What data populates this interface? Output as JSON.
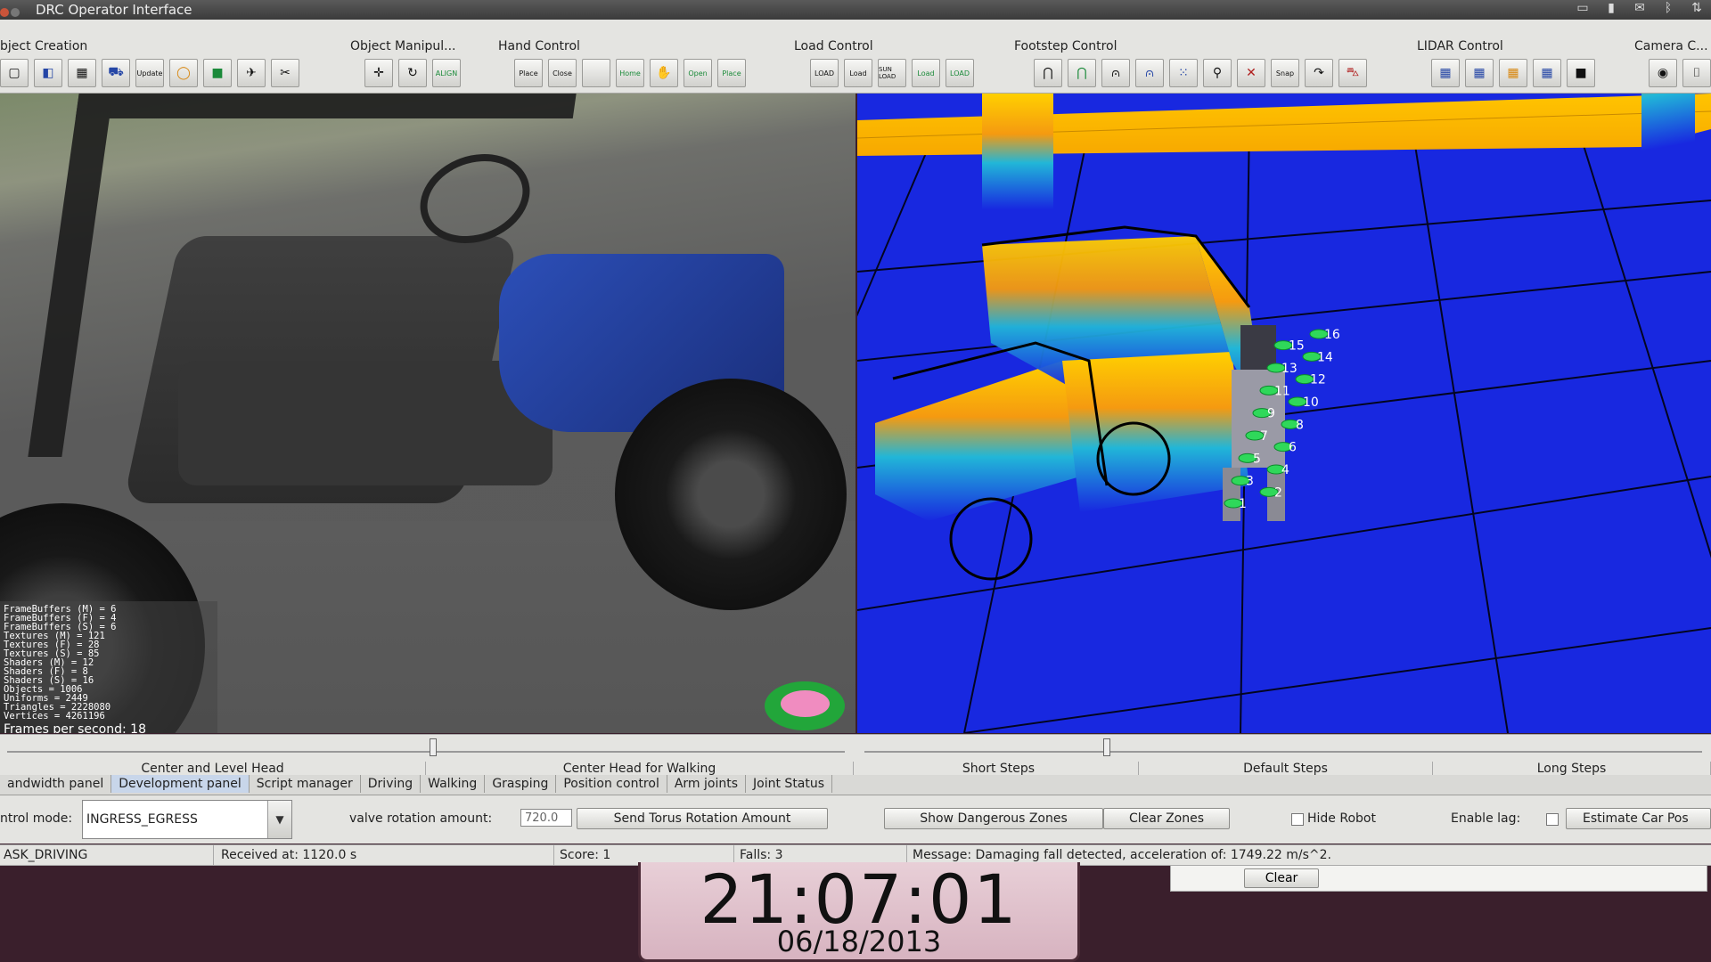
{
  "window": {
    "title": "DRC Operator Interface"
  },
  "toolbar": {
    "groups": [
      {
        "label": "bject Creation",
        "buttons": [
          "clear-icon",
          "car-model-icon",
          "grid-icon",
          "vehicle-icon",
          "update-icon",
          "torus-icon",
          "box-icon",
          "hose-icon",
          "tool-icon"
        ]
      },
      {
        "label": "Object Manipul...",
        "buttons": [
          "move-icon",
          "rotate-icon",
          "align-icon"
        ]
      },
      {
        "label": "Hand Control",
        "buttons": [
          "place-icon",
          "close-icon",
          "blank-icon",
          "home-icon",
          "grasp-icon",
          "open-icon",
          "place-icon"
        ]
      },
      {
        "label": "Load Control",
        "buttons": [
          "load-icon",
          "load-icon",
          "sun-load-icon",
          "load-icon",
          "load-icon"
        ]
      },
      {
        "label": "Footstep Control",
        "buttons": [
          "step-icon",
          "step-icon",
          "step-icon",
          "step-icon",
          "grid-steps-icon",
          "walk-icon",
          "cancel-steps-icon",
          "snap-icon",
          "turn-icon",
          "car-icon"
        ]
      },
      {
        "label": "LIDAR Control",
        "buttons": [
          "lidar-icon",
          "lidar-icon",
          "lidar-icon",
          "lidar-icon",
          "lidar-icon"
        ]
      },
      {
        "label": "Camera C...",
        "buttons": [
          "eye-icon",
          "camera-icon"
        ]
      }
    ],
    "button_text": {
      "update": "Update",
      "align": "ALIGN",
      "place": "Place",
      "close": "Close",
      "home": "Home",
      "open": "Open",
      "load": "LOAD",
      "load2": "Load",
      "sun_load": "SUN LOAD",
      "snap": "Snap"
    }
  },
  "camera_view": {
    "stats": [
      "FrameBuffers (M) = 6",
      "FrameBuffers (F) = 4",
      "FrameBuffers (S) = 6",
      "Textures (M) = 121",
      "Textures (F) = 28",
      "Textures (S) = 85",
      "Shaders (M) = 12",
      "Shaders (F) = 8",
      "Shaders (S) = 16",
      "Objects = 1006",
      "Uniforms = 2449",
      "Triangles = 2228080",
      "Vertices = 4261196"
    ],
    "fps": "Frames per second: 18"
  },
  "lidar_view": {
    "footstep_numbers": [
      "1",
      "2",
      "3",
      "4",
      "5",
      "6",
      "7",
      "8",
      "9",
      "10",
      "11",
      "12",
      "13",
      "14",
      "15",
      "16"
    ]
  },
  "sliders": {
    "left_labels": [
      "Center and Level Head",
      "Center Head for Walking"
    ],
    "right_labels": [
      "Short Steps",
      "Default Steps",
      "Long Steps"
    ]
  },
  "tabs": [
    {
      "label": "andwidth panel",
      "active": false
    },
    {
      "label": "Development panel",
      "active": true
    },
    {
      "label": "Script manager",
      "active": false
    },
    {
      "label": "Driving",
      "active": false
    },
    {
      "label": "Walking",
      "active": false
    },
    {
      "label": "Grasping",
      "active": false
    },
    {
      "label": "Position control",
      "active": false
    },
    {
      "label": "Arm joints",
      "active": false
    },
    {
      "label": "Joint Status",
      "active": false
    }
  ],
  "controls": {
    "control_mode_label": "ntrol mode:",
    "control_mode_value": "INGRESS_EGRESS",
    "valve_label": "valve rotation amount:",
    "valve_value": "720.0",
    "send_torus": "Send Torus Rotation Amount",
    "show_zones": "Show Dangerous Zones",
    "clear_zones": "Clear Zones",
    "hide_robot": "Hide Robot",
    "enable_lag": "Enable lag:",
    "estimate_car": "Estimate Car Pos"
  },
  "status": {
    "task": "ASK_DRIVING",
    "received": "Received at:  1120.0 s",
    "score": "Score:  1",
    "falls": "Falls:  3",
    "message": "Message:  Damaging fall detected, acceleration of: 1749.22 m/s^2."
  },
  "message_panel": {
    "clear": "Clear"
  },
  "clock": {
    "time": "21:07:01",
    "date": "06/18/2013"
  },
  "colors": {
    "lidar_floor": "#1828e0",
    "accent_tab": "#c8d6ea",
    "panel_bg": "#e4e4e1"
  }
}
